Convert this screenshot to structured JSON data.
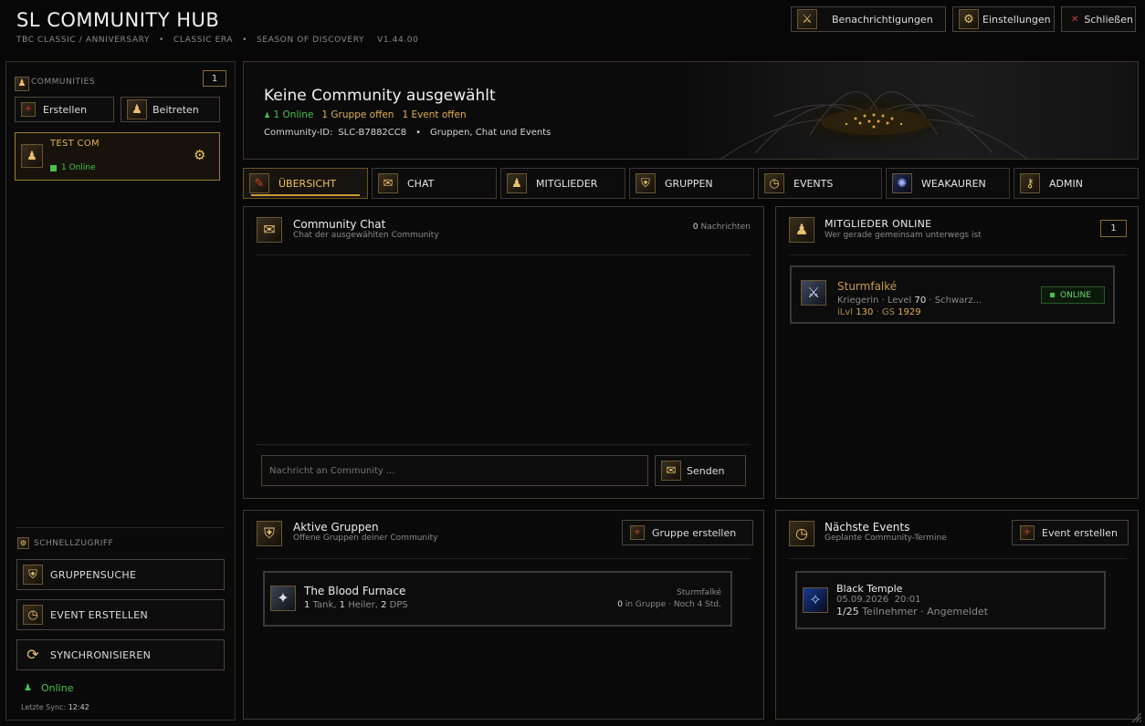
{
  "app": {
    "title": "SL COMMUNITY HUB",
    "subtitle_parts": [
      "TBC CLASSIC / ANNIVERSARY",
      "CLASSIC ERA",
      "SEASON OF DISCOVERY"
    ],
    "version": "v1.44.00"
  },
  "header_buttons": {
    "notifications": "Benachrichtigungen",
    "settings": "Einstellungen",
    "close": "Schließen"
  },
  "sidebar": {
    "communities_heading": "COMMUNITIES",
    "communities_count": "1",
    "create": "Erstellen",
    "join": "Beitreten",
    "community": {
      "name": "TEST COM",
      "online": "1 Online"
    },
    "quick_heading": "SCHNELLZUGRIFF",
    "quick": [
      "GRUPPENSUCHE",
      "EVENT ERSTELLEN",
      "SYNCHRONISIEREN"
    ],
    "status": "Online",
    "last_sync_label": "Letzte Sync:",
    "last_sync_time": "12:42"
  },
  "banner": {
    "title": "Keine Community ausgewählt",
    "online": "1 Online",
    "groups": "1 Gruppe offen",
    "events": "1 Event offen",
    "community_id_label": "Community-ID:",
    "community_id": "SLC-B7882CC8",
    "tagline": "Gruppen, Chat und Events"
  },
  "tabs": [
    "ÜBERSICHT",
    "CHAT",
    "MITGLIEDER",
    "GRUPPEN",
    "EVENTS",
    "WEAKAUREN",
    "ADMIN"
  ],
  "chat": {
    "title": "Community Chat",
    "subtitle": "Chat der ausgewählten Community",
    "count_num": "0",
    "count_label": "Nachrichten",
    "placeholder": "Nachricht an Community ...",
    "send": "Senden"
  },
  "members": {
    "title": "MITGLIEDER ONLINE",
    "subtitle": "Wer gerade gemeinsam unterwegs ist",
    "count": "1",
    "member": {
      "name": "Sturmfalké",
      "class": "Kriegerin",
      "level_label": "Level",
      "level": "70",
      "zone": "Schwarz...",
      "ilvl_label": "iLvl",
      "ilvl": "130",
      "gs_label": "GS",
      "gs": "1929",
      "status": "ONLINE"
    }
  },
  "groups": {
    "title": "Aktive Gruppen",
    "subtitle": "Offene Gruppen deiner Community",
    "create": "Gruppe erstellen",
    "item": {
      "name": "The Blood Furnace",
      "tank_n": "1",
      "tank_l": "Tank,",
      "heal_n": "1",
      "heal_l": "Heiler,",
      "dps_n": "2",
      "dps_l": "DPS",
      "leader": "Sturmfalké",
      "in_group_n": "0",
      "in_group_l": "in Gruppe · Noch 4 Std."
    }
  },
  "events": {
    "title": "Nächste Events",
    "subtitle": "Geplante Community-Termine",
    "create": "Event erstellen",
    "item": {
      "name": "Black Temple",
      "datetime": "05.09.2026  20:01",
      "participants": "1/25",
      "participants_label": "Teilnehmer",
      "status": "Angemeldet"
    }
  },
  "colors": {
    "accent": "#e0b050",
    "online": "#49c24e",
    "border": "#34302a"
  }
}
